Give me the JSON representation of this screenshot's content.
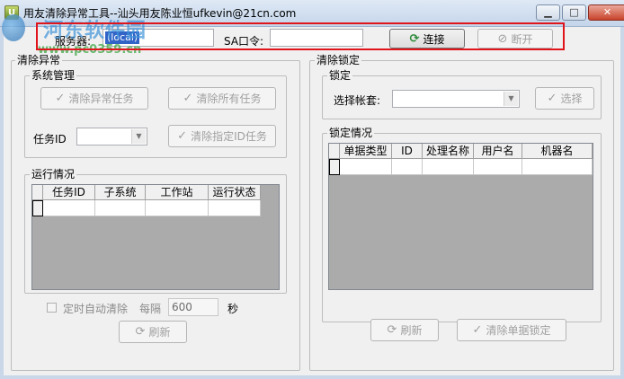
{
  "window": {
    "title": "用友清除异常工具--汕头用友陈业恒ufkevin@21cn.com",
    "app_icon_text": "U",
    "controls": {
      "minimize": "▁",
      "maximize": "□",
      "close": "✕"
    }
  },
  "watermark": {
    "name": "河东软件园",
    "url": "www.pc0359.cn"
  },
  "connection": {
    "server_label": "服务器:",
    "server_value": "(local)",
    "sa_label": "SA口令:",
    "sa_value": "",
    "connect_label": "连接",
    "disconnect_label": "断开"
  },
  "clear_exception": {
    "title": "清除异常",
    "system_mgmt": {
      "title": "系统管理",
      "clear_exception_tasks": "清除异常任务",
      "clear_all_tasks": "清除所有任务",
      "task_id_label": "任务ID",
      "task_id_value": "",
      "clear_by_id": "清除指定ID任务"
    },
    "running": {
      "title": "运行情况",
      "columns": [
        "任务ID",
        "子系统",
        "工作站",
        "运行状态"
      ]
    },
    "auto_clear_label": "定时自动清除",
    "interval_label": "每隔",
    "interval_value": "600",
    "unit_label": "秒",
    "refresh_label": "刷新"
  },
  "clear_lock": {
    "title": "清除锁定",
    "lock": {
      "title": "锁定",
      "account_label": "选择帐套:",
      "account_value": "",
      "select_label": "选择"
    },
    "lock_status": {
      "title": "锁定情况",
      "columns": [
        "单据类型",
        "ID",
        "处理名称",
        "用户名",
        "机器名"
      ]
    },
    "refresh_label": "刷新",
    "clear_doc_lock_label": "清除单据锁定"
  },
  "colors": {
    "highlight": "#e0141b",
    "link_blue": "#0a246a",
    "connect_icon": "#2e8b3a"
  }
}
